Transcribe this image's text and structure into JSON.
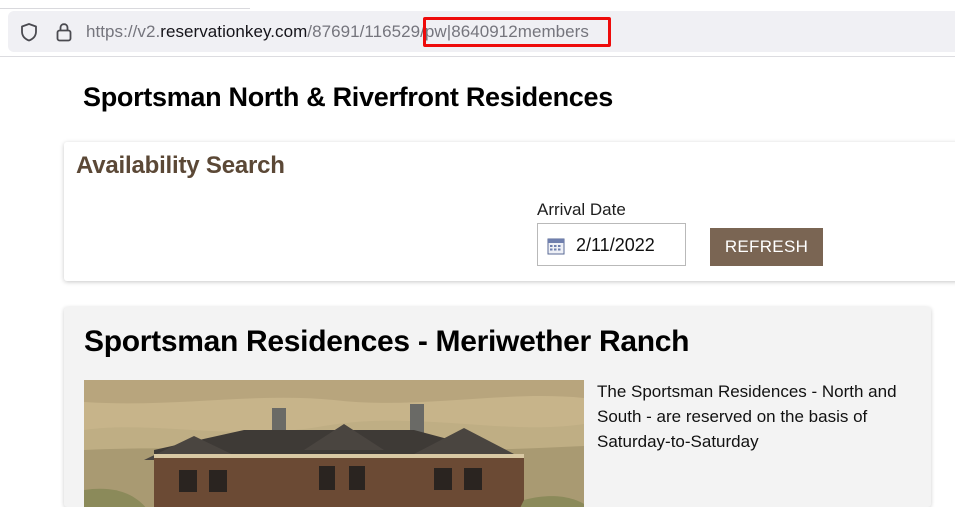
{
  "browser": {
    "url_prefix": "https://v2.",
    "url_domain": "reservationkey.com",
    "url_path": "/87691/116529/",
    "url_highlighted": "pw|8640912members",
    "highlight_color": "#ee0b0b",
    "icons": [
      "shield-icon",
      "lock-icon"
    ]
  },
  "page": {
    "title": "Sportsman North & Riverfront Residences"
  },
  "search": {
    "heading": "Availability Search",
    "arrival_label": "Arrival Date",
    "arrival_value": "2/11/2022",
    "refresh_label": "REFRESH",
    "accent_color": "#7a6553",
    "heading_color": "#5b4836",
    "icons": [
      "calendar-icon"
    ]
  },
  "property": {
    "title": "Sportsman Residences - Meriwether Ranch",
    "description": "The Sportsman Residences - North and South - are reserved on the basis of Saturday-to-Saturday"
  }
}
